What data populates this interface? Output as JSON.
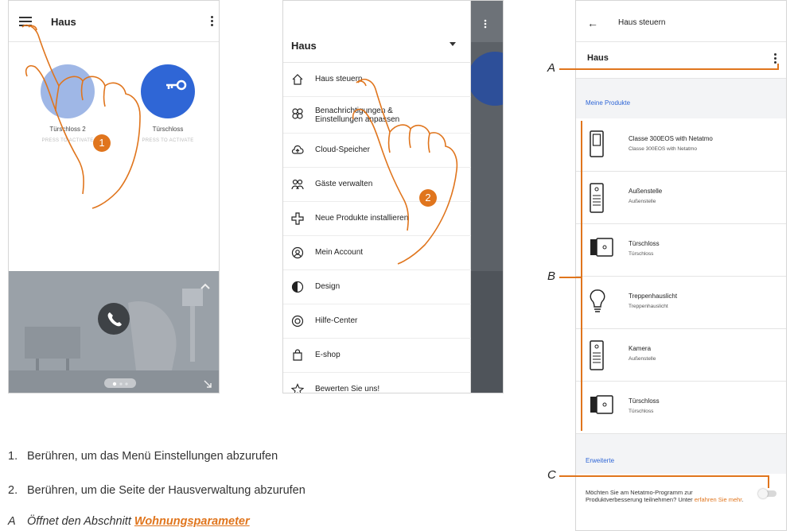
{
  "screen1": {
    "title": "Haus",
    "tiles": [
      {
        "name": "Türschloss 2",
        "sub": "PRESS TO ACTIVATE"
      },
      {
        "name": "Türschloss",
        "sub": "PRESS TO ACTIVATE"
      }
    ],
    "badge": "1"
  },
  "screen2": {
    "title": "Haus",
    "menu": [
      {
        "label": "Haus steuern",
        "icon": "home-icon"
      },
      {
        "label": "Benachrichtigungen & Einstellungen anpassen",
        "icon": "settings-icon"
      },
      {
        "label": "Cloud-Speicher",
        "icon": "cloud-icon"
      },
      {
        "label": "Gäste verwalten",
        "icon": "guests-icon"
      },
      {
        "label": "Neue Produkte installieren",
        "icon": "add-product-icon"
      },
      {
        "label": "Mein Account",
        "icon": "account-icon"
      },
      {
        "label": "Design",
        "icon": "design-icon"
      },
      {
        "label": "Hilfe-Center",
        "icon": "help-icon"
      },
      {
        "label": "E-shop",
        "icon": "shop-icon"
      },
      {
        "label": "Bewerten Sie uns!",
        "icon": "star-icon"
      }
    ],
    "badge": "2"
  },
  "screen3": {
    "title": "Haus steuern",
    "home": "Haus",
    "products_section": "Meine Produkte",
    "products": [
      {
        "name": "Classe 300EOS with Netatmo",
        "sub": "Classe 300EOS with Netatmo",
        "icon": "indoor-unit-icon"
      },
      {
        "name": "Außenstelle",
        "sub": "Außenstelle",
        "icon": "entrance-panel-icon"
      },
      {
        "name": "Türschloss",
        "sub": "Türschloss",
        "icon": "door-lock-icon"
      },
      {
        "name": "Treppenhauslicht",
        "sub": "Treppenhauslicht",
        "icon": "light-bulb-icon"
      },
      {
        "name": "Kamera",
        "sub": "Außenstelle",
        "icon": "entrance-panel-icon"
      },
      {
        "name": "Türschloss",
        "sub": "Türschloss",
        "icon": "door-lock-icon"
      }
    ],
    "advanced_section": "Erweiterte",
    "program_text": "Möchten Sie am Netatmo-Programm zur Produktverbesserung teilnehmen? Unter",
    "program_link": "erfahren Sie mehr",
    "program_end": "."
  },
  "callouts": {
    "a": "A",
    "b": "B",
    "c": "C"
  },
  "legend": {
    "item1_num": "1.",
    "item1": "Berühren, um das Menü Einstellungen abzurufen",
    "item2_num": "2.",
    "item2": "Berühren, um die Seite der Hausverwaltung abzurufen",
    "itemA_letter": "A",
    "itemA_text": "Öffnet den Abschnitt",
    "itemA_link": "Wohnungsparameter"
  },
  "colors": {
    "accent": "#e0751d",
    "blue": "#2f66d6"
  }
}
